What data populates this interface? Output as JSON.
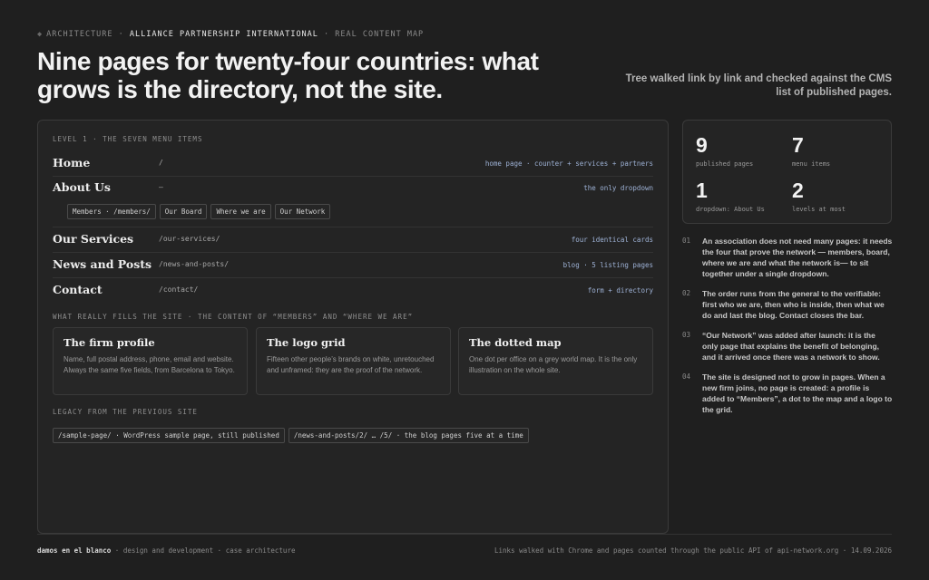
{
  "header": {
    "crumb_1": "ARCHITECTURE",
    "crumb_2": "ALLIANCE PARTNERSHIP INTERNATIONAL",
    "crumb_3": "REAL CONTENT MAP",
    "separator": "·",
    "title": "Nine pages for twenty-four countries: what grows is the directory, not the site.",
    "lede": "Tree walked link by link and checked against the CMS list of published pages."
  },
  "level1": {
    "heading": "LEVEL 1 · THE SEVEN MENU ITEMS",
    "items": [
      {
        "label": "Home",
        "path": "/",
        "note": "home page · counter + services + partners"
      },
      {
        "label": "About Us",
        "path": "—",
        "note": "the only dropdown"
      },
      {
        "label": "Our Services",
        "path": "/our-services/",
        "note": "four identical cards"
      },
      {
        "label": "News and Posts",
        "path": "/news-and-posts/",
        "note": "blog · 5 listing pages"
      },
      {
        "label": "Contact",
        "path": "/contact/",
        "note": "form + directory"
      }
    ],
    "submenu": [
      "Members · /members/",
      "Our Board",
      "Where we are",
      "Our Network"
    ]
  },
  "content": {
    "heading": "WHAT REALLY FILLS THE SITE · THE CONTENT OF “MEMBERS” AND “WHERE WE ARE”",
    "cards": [
      {
        "title": "The firm profile",
        "desc": "Name, full postal address, phone, email and website. Always the same five fields, from Barcelona to Tokyo."
      },
      {
        "title": "The logo grid",
        "desc": "Fifteen other people’s brands on white, unretouched and unframed: they are the proof of the network."
      },
      {
        "title": "The dotted map",
        "desc": "One dot per office on a grey world map. It is the only illustration on the whole site."
      }
    ]
  },
  "legacy": {
    "heading": "LEGACY FROM THE PREVIOUS SITE",
    "items": [
      "/sample-page/ · WordPress sample page, still published",
      "/news-and-posts/2/ … /5/ · the blog pages five at a time"
    ]
  },
  "stats": [
    {
      "num": "9",
      "label": "published pages"
    },
    {
      "num": "7",
      "label": "menu items"
    },
    {
      "num": "1",
      "label": "dropdown: About Us"
    },
    {
      "num": "2",
      "label": "levels at most"
    }
  ],
  "notes": [
    {
      "n": "01",
      "text": "An association does not need many pages: it needs the four that prove the network — members, board, where we are and what the network is— to sit together under a single dropdown."
    },
    {
      "n": "02",
      "text": "The order runs from the general to the verifiable: first who we are, then who is inside, then what we do and last the blog. Contact closes the bar."
    },
    {
      "n": "03",
      "text": "“Our Network” was added after launch: it is the only page that explains the benefit of belonging, and it arrived once there was a network to show."
    },
    {
      "n": "04",
      "text": "The site is designed not to grow in pages. When a new firm joins, no page is created: a profile is added to “Members”, a dot to the map and a logo to the grid."
    }
  ],
  "footer": {
    "brand": "damos en el blanco",
    "tagline": "· design and development · case architecture",
    "right": "Links walked with Chrome and pages counted through the public API of api-network.org · 14.09.2026"
  }
}
